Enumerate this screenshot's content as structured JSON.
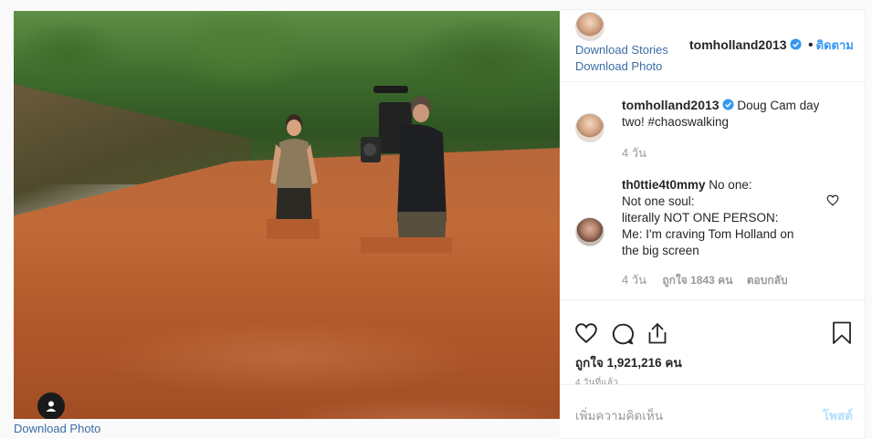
{
  "photo": {
    "download_label": "Download Photo"
  },
  "header": {
    "download_stories": "Download Stories",
    "download_photo": "Download Photo",
    "username": "tomholland2013",
    "separator": "•",
    "follow_label": "ติดตาม"
  },
  "caption": {
    "username": "tomholland2013",
    "text_line1": "Doug Cam day",
    "text_line2": "two! #chaoswalking",
    "time": "4 วัน"
  },
  "comment": {
    "username": "th0ttie4t0mmy",
    "line1": "No one:",
    "line2": "Not one soul:",
    "line3": "literally NOT ONE PERSON:",
    "line4": "Me: I'm craving Tom Holland on",
    "line5": "the big screen",
    "time": "4 วัน",
    "likes": "ถูกใจ 1843 คน",
    "reply": "ตอบกลับ"
  },
  "actions": {
    "likes_label": "ถูกใจ 1,921,216 คน",
    "time_ago": "4 วันที่แล้ว"
  },
  "add_comment": {
    "placeholder": "เพิ่มความคิดเห็น",
    "post_label": "โพสต์"
  },
  "colors": {
    "link": "#3a6ea5",
    "accent": "#3897f0",
    "post_disabled": "#b2dffc"
  }
}
